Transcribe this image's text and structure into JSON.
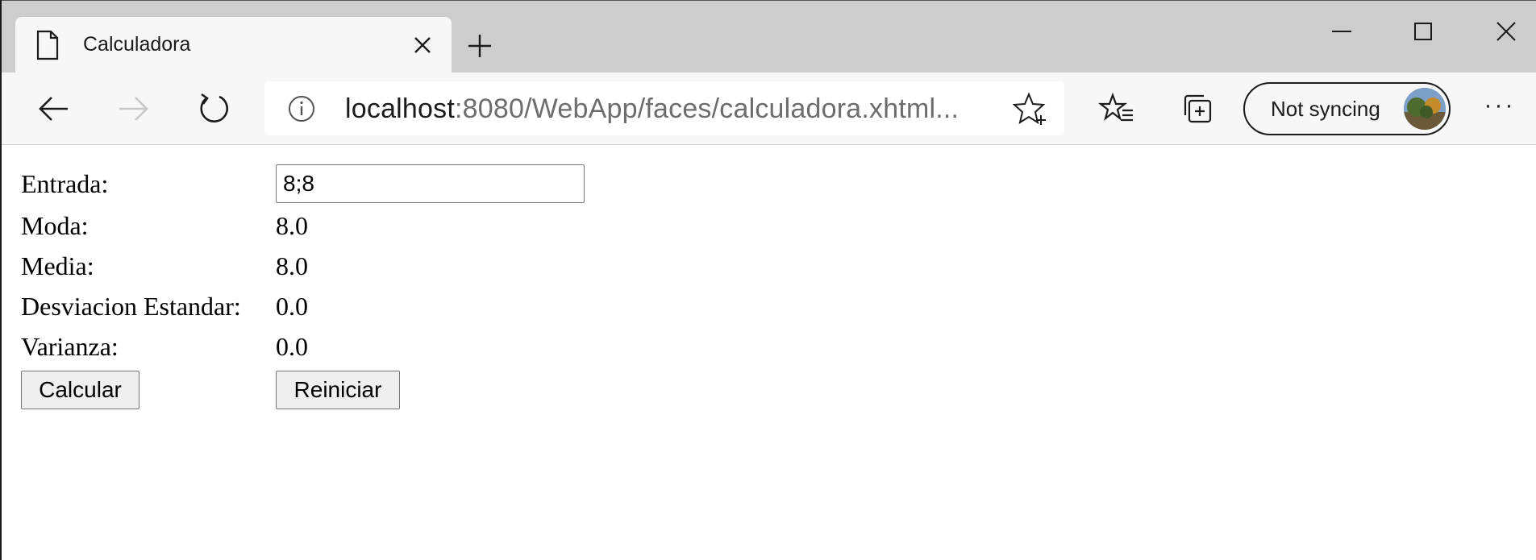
{
  "browser": {
    "tab_title": "Calculadora",
    "address": {
      "host": "localhost",
      "rest": ":8080/WebApp/faces/calculadora.xhtml..."
    },
    "sync_label": "Not syncing",
    "more_label": "···"
  },
  "icons": {
    "tab": "document-icon",
    "close": "close-icon",
    "new_tab": "plus-icon",
    "back": "back-arrow-icon",
    "forward": "forward-arrow-icon",
    "refresh": "refresh-icon",
    "info": "info-icon",
    "favorite": "star-add-icon",
    "favorites": "favorites-list-icon",
    "collections": "collections-icon",
    "avatar": "avatar",
    "more": "more-icon"
  },
  "colors": {
    "tab_strip": "#cdcdcd",
    "toolbar": "#f7f7f7",
    "url_muted": "#6d6d6d"
  },
  "page": {
    "entrada": {
      "label": "Entrada:",
      "value": "8;8"
    },
    "moda": {
      "label": "Moda:",
      "value": "8.0"
    },
    "media": {
      "label": "Media:",
      "value": "8.0"
    },
    "desviacion": {
      "label": "Desviacion Estandar:",
      "value": "0.0"
    },
    "varianza": {
      "label": "Varianza:",
      "value": "0.0"
    },
    "calcular_label": "Calcular",
    "reiniciar_label": "Reiniciar"
  }
}
